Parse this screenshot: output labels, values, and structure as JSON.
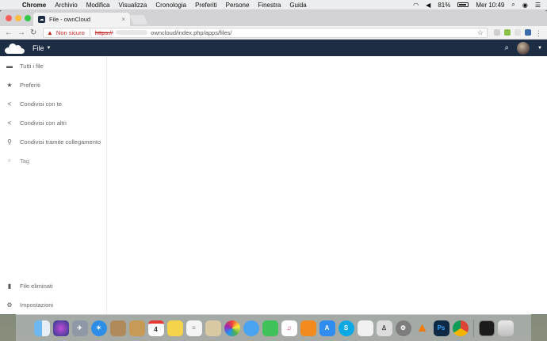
{
  "menubar": {
    "app": "Chrome",
    "items": [
      "Archivio",
      "Modifica",
      "Visualizza",
      "Cronologia",
      "Preferiti",
      "Persone",
      "Finestra",
      "Guida"
    ],
    "battery": "81%",
    "clock": "Mer 10:49"
  },
  "browser": {
    "tab_title": "File - ownCloud",
    "security_label": "Non sicuro",
    "url_scheme": "https://",
    "url_path": "owncloud/index.php/apps/files/"
  },
  "header": {
    "app_name": "File"
  },
  "sidebar": {
    "items": [
      {
        "label": "Tutti i file",
        "icon": "folder-icon"
      },
      {
        "label": "Preferiti",
        "icon": "star-icon"
      },
      {
        "label": "Condivisi con te",
        "icon": "share-icon"
      },
      {
        "label": "Condivisi con altri",
        "icon": "share-icon"
      },
      {
        "label": "Condivisi tramite collegamento",
        "icon": "link-icon"
      },
      {
        "label": "Tag",
        "icon": "search-icon"
      }
    ],
    "bottom": [
      {
        "label": "File eliminati",
        "icon": "trash-icon"
      },
      {
        "label": "Impostazioni",
        "icon": "gear-icon"
      }
    ]
  },
  "colors": {
    "header_bg": "#1d2d44",
    "insecure": "#c5221f"
  },
  "dock_icons": [
    "finder-icon",
    "siri-icon",
    "launchpad-icon",
    "safari-icon",
    "contacts-icon",
    "notes-icon",
    "calendar-icon",
    "stickies-icon",
    "reminders-icon",
    "preview-icon",
    "photos-icon",
    "messages-icon",
    "facetime-icon",
    "music-icon",
    "books-icon",
    "appstore-icon",
    "skype-icon",
    "textedit-icon",
    "automator-icon",
    "system-preferences-icon",
    "vlc-icon",
    "photoshop-icon",
    "chrome-icon",
    "terminal-icon",
    "trash-icon"
  ]
}
